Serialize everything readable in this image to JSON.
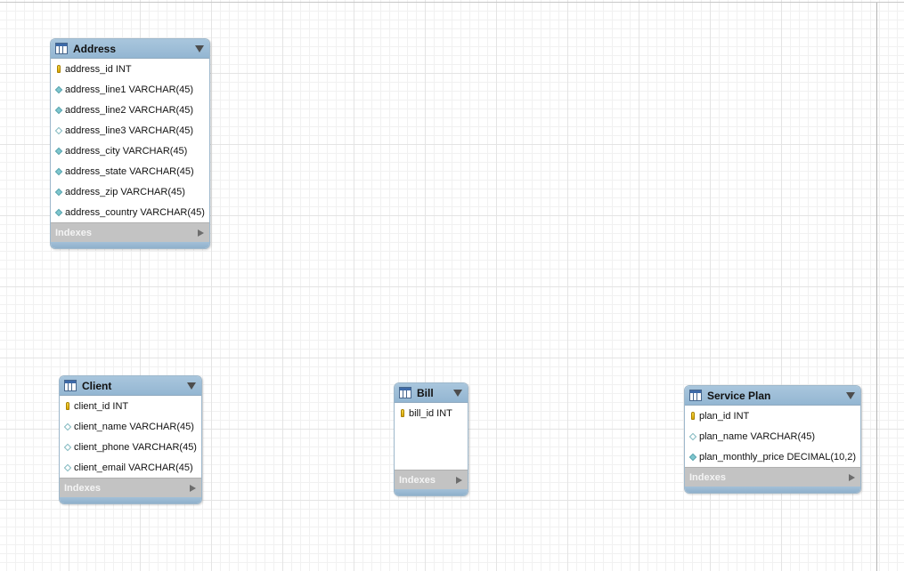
{
  "entities": [
    {
      "title": "Address",
      "columns": [
        {
          "icon": "primary-key-icon",
          "label": "address_id INT"
        },
        {
          "icon": "column-filled-icon",
          "label": "address_line1 VARCHAR(45)"
        },
        {
          "icon": "column-filled-icon",
          "label": "address_line2 VARCHAR(45)"
        },
        {
          "icon": "column-nullable-icon",
          "label": "address_line3 VARCHAR(45)"
        },
        {
          "icon": "column-filled-icon",
          "label": "address_city VARCHAR(45)"
        },
        {
          "icon": "column-filled-icon",
          "label": "address_state VARCHAR(45)"
        },
        {
          "icon": "column-filled-icon",
          "label": "address_zip VARCHAR(45)"
        },
        {
          "icon": "column-filled-icon",
          "label": "address_country VARCHAR(45)"
        }
      ],
      "indexes_label": "Indexes"
    },
    {
      "title": "Client",
      "columns": [
        {
          "icon": "primary-key-icon",
          "label": "client_id INT"
        },
        {
          "icon": "column-nullable-icon",
          "label": "client_name VARCHAR(45)"
        },
        {
          "icon": "column-nullable-icon",
          "label": "client_phone VARCHAR(45)"
        },
        {
          "icon": "column-nullable-icon",
          "label": "client_email VARCHAR(45)"
        }
      ],
      "indexes_label": "Indexes"
    },
    {
      "title": "Bill",
      "columns": [
        {
          "icon": "primary-key-icon",
          "label": "bill_id INT"
        }
      ],
      "indexes_label": "Indexes"
    },
    {
      "title": "Service Plan",
      "columns": [
        {
          "icon": "primary-key-icon",
          "label": "plan_id INT"
        },
        {
          "icon": "column-nullable-icon",
          "label": "plan_name VARCHAR(45)"
        },
        {
          "icon": "column-filled-icon",
          "label": "plan_monthly_price DECIMAL(10,2)"
        }
      ],
      "indexes_label": "Indexes"
    }
  ],
  "colors": {
    "header": "#9ebfd9",
    "indexes_bar": "#c3c3c3",
    "primary_key": "#e8c21a",
    "column_marker": "#7ec6ce"
  }
}
